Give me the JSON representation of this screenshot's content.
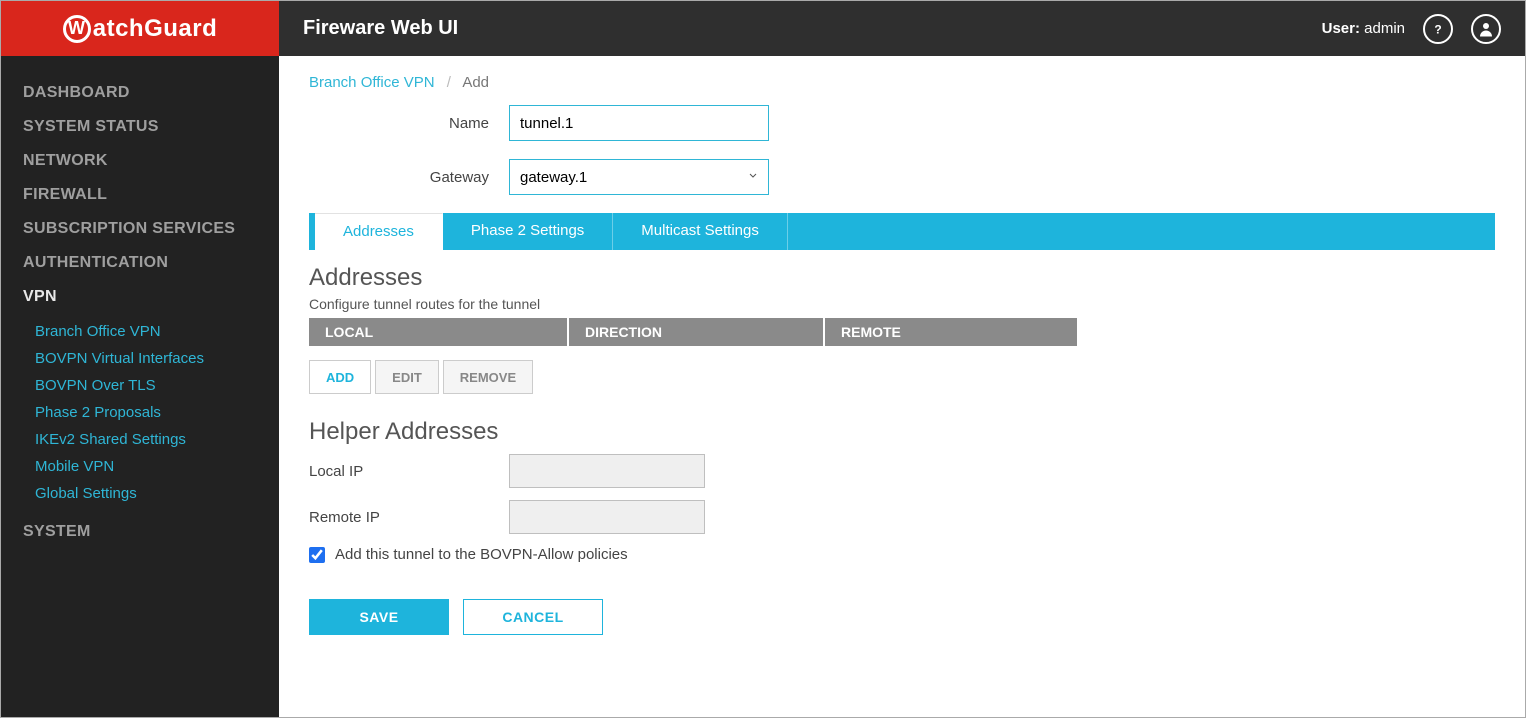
{
  "header": {
    "app_title": "Fireware Web UI",
    "logo_text": "atchGuard",
    "user_prefix": "User:",
    "user_name": "admin"
  },
  "sidebar": {
    "items": [
      {
        "label": "DASHBOARD"
      },
      {
        "label": "SYSTEM STATUS"
      },
      {
        "label": "NETWORK"
      },
      {
        "label": "FIREWALL"
      },
      {
        "label": "SUBSCRIPTION SERVICES"
      },
      {
        "label": "AUTHENTICATION"
      },
      {
        "label": "VPN"
      },
      {
        "label": "SYSTEM"
      }
    ],
    "vpn_sub": [
      {
        "label": "Branch Office VPN"
      },
      {
        "label": "BOVPN Virtual Interfaces"
      },
      {
        "label": "BOVPN Over TLS"
      },
      {
        "label": "Phase 2 Proposals"
      },
      {
        "label": "IKEv2 Shared Settings"
      },
      {
        "label": "Mobile VPN"
      },
      {
        "label": "Global Settings"
      }
    ]
  },
  "breadcrumb": {
    "parent": "Branch Office VPN",
    "current": "Add"
  },
  "form": {
    "name_label": "Name",
    "name_value": "tunnel.1",
    "gateway_label": "Gateway",
    "gateway_value": "gateway.1"
  },
  "tabs": [
    {
      "label": "Addresses",
      "active": true
    },
    {
      "label": "Phase 2 Settings",
      "active": false
    },
    {
      "label": "Multicast Settings",
      "active": false
    }
  ],
  "addresses": {
    "heading": "Addresses",
    "description": "Configure tunnel routes for the tunnel",
    "columns": {
      "local": "LOCAL",
      "direction": "DIRECTION",
      "remote": "REMOTE"
    },
    "buttons": {
      "add": "ADD",
      "edit": "EDIT",
      "remove": "REMOVE"
    }
  },
  "helper": {
    "heading": "Helper Addresses",
    "local_label": "Local IP",
    "remote_label": "Remote IP",
    "checkbox_label": "Add this tunnel to the BOVPN-Allow policies",
    "checkbox_checked": true
  },
  "footer": {
    "save": "SAVE",
    "cancel": "CANCEL"
  }
}
